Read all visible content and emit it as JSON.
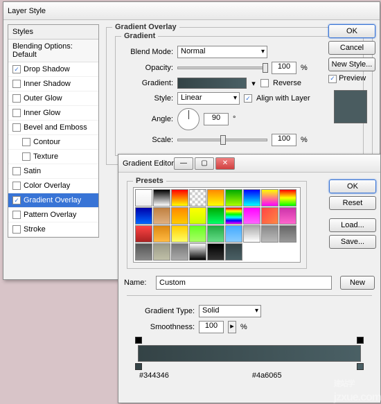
{
  "layerStyle": {
    "title": "Layer Style",
    "stylesHeader": "Styles",
    "blendingDefault": "Blending Options: Default",
    "items": [
      {
        "label": "Drop Shadow",
        "checked": true,
        "indent": false
      },
      {
        "label": "Inner Shadow",
        "checked": false,
        "indent": false
      },
      {
        "label": "Outer Glow",
        "checked": false,
        "indent": false
      },
      {
        "label": "Inner Glow",
        "checked": false,
        "indent": false
      },
      {
        "label": "Bevel and Emboss",
        "checked": false,
        "indent": false
      },
      {
        "label": "Contour",
        "checked": false,
        "indent": true
      },
      {
        "label": "Texture",
        "checked": false,
        "indent": true
      },
      {
        "label": "Satin",
        "checked": false,
        "indent": false
      },
      {
        "label": "Color Overlay",
        "checked": false,
        "indent": false
      },
      {
        "label": "Gradient Overlay",
        "checked": true,
        "indent": false,
        "selected": true
      },
      {
        "label": "Pattern Overlay",
        "checked": false,
        "indent": false
      },
      {
        "label": "Stroke",
        "checked": false,
        "indent": false
      }
    ],
    "section": "Gradient Overlay",
    "subsection": "Gradient",
    "labels": {
      "blendMode": "Blend Mode:",
      "opacity": "Opacity:",
      "gradient": "Gradient:",
      "style": "Style:",
      "angle": "Angle:",
      "scale": "Scale:",
      "reverse": "Reverse",
      "align": "Align with Layer"
    },
    "values": {
      "blendMode": "Normal",
      "opacity": "100",
      "style": "Linear",
      "angle": "90",
      "scale": "100",
      "pct": "%",
      "deg": "°",
      "alignChecked": true
    },
    "buttons": {
      "ok": "OK",
      "cancel": "Cancel",
      "newStyle": "New Style...",
      "preview": "Preview"
    }
  },
  "gradientEditor": {
    "title": "Gradient Editor",
    "presets": "Presets",
    "swatches": [
      "linear-gradient(#fff,#eee)",
      "linear-gradient(#000,#fff)",
      "linear-gradient(#f00,#ff0)",
      "repeating-conic-gradient(#ccc 0 25%,#fff 0 50%) 50%/8px 8px",
      "linear-gradient(#f80,#ff0)",
      "linear-gradient(#0a0,#af0)",
      "linear-gradient(#00f,#0ff)",
      "linear-gradient(#ff0,#f0f)",
      "linear-gradient(#f00,#ff0,#0f0)",
      "linear-gradient(#00a,#0066ff)",
      "linear-gradient(#c08040,#e0b080)",
      "linear-gradient(#f80,#fc0)",
      "linear-gradient(#ff0,#cf0)",
      "linear-gradient(#0a0,#0f6)",
      "linear-gradient(#f00,#ff0,#0f0,#0ff,#00f,#f0f)",
      "linear-gradient(#f0f,#f6f)",
      "linear-gradient(135deg,#f44,#f84)",
      "linear-gradient(#c3a,#f6c)",
      "linear-gradient(#f44,#a22)",
      "linear-gradient(#d81,#fb4)",
      "linear-gradient(#fc0,#ff6)",
      "linear-gradient(#6f2,#af6)",
      "linear-gradient(#2a4,#6d8)",
      "linear-gradient(#4af,#8cf)",
      "linear-gradient(#aaa,#fff)",
      "linear-gradient(#888,#bbb)",
      "linear-gradient(#666,#999)",
      "linear-gradient(#555,#888)",
      "linear-gradient(#9a9a88,#c0c0a8)",
      "linear-gradient(#777,#aaa)",
      "linear-gradient(#fff,#000)",
      "linear-gradient(#000,#333)",
      "linear-gradient(#344346,#4a6065)"
    ],
    "nameLabel": "Name:",
    "nameValue": "Custom",
    "gradTypeLabel": "Gradient Type:",
    "gradTypeValue": "Solid",
    "smoothLabel": "Smoothness:",
    "smoothValue": "100",
    "pct": "%",
    "hex1": "#344346",
    "hex2": "#4a6065",
    "buttons": {
      "ok": "OK",
      "reset": "Reset",
      "load": "Load...",
      "save": "Save...",
      "new": "New"
    }
  },
  "watermark": {
    "main": "建站学",
    "sub": "jzxue.com"
  }
}
